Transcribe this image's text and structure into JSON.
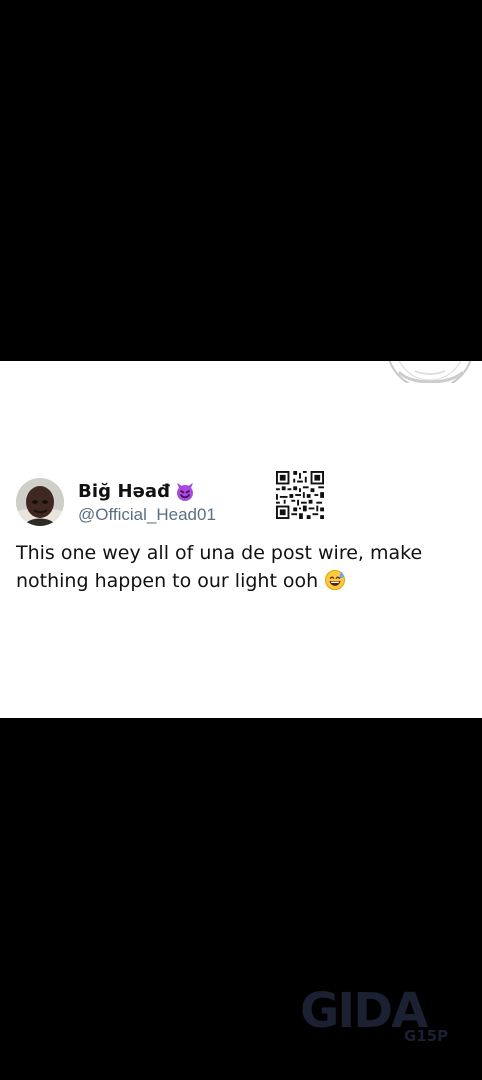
{
  "tweet": {
    "display_name": "Biğ Həađ",
    "name_emoji": "smiling-devil",
    "handle": "@Official_Head01",
    "text": "This one wey all of una de post wire, make nothing happen to our light ooh",
    "trailing_emoji": "grinning-sweat"
  },
  "watermark": {
    "brand": "GIDA",
    "sub": "G15P"
  },
  "colors": {
    "background": "#000000",
    "card": "#ffffff",
    "text": "#111111",
    "handle": "#5b7083",
    "devil_purple": "#a94adf",
    "watermark": "#1b2032"
  }
}
